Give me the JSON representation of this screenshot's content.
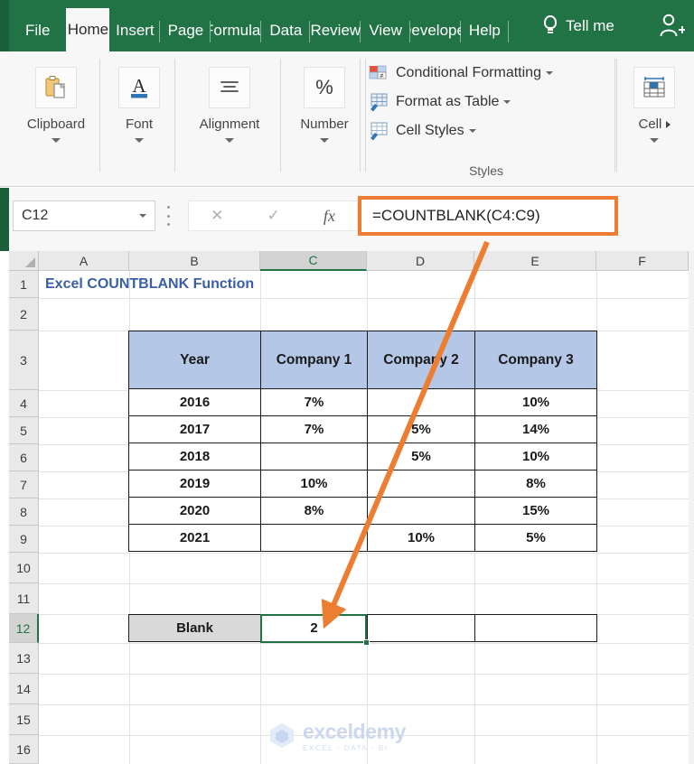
{
  "ribbon": {
    "tabs": [
      {
        "label": "File",
        "active": false
      },
      {
        "label": "Home",
        "active": true
      },
      {
        "label": "Insert",
        "active": false
      },
      {
        "label": "Page",
        "active": false
      },
      {
        "label": "Formulas",
        "active": false
      },
      {
        "label": "Data",
        "active": false
      },
      {
        "label": "Review",
        "active": false
      },
      {
        "label": "View",
        "active": false
      },
      {
        "label": "Developer",
        "active": false
      },
      {
        "label": "Help",
        "active": false
      }
    ],
    "tell_me": "Tell me",
    "groups": [
      {
        "label": "Clipboard",
        "icon": "clipboard-icon"
      },
      {
        "label": "Font",
        "icon": "font-a-icon"
      },
      {
        "label": "Alignment",
        "icon": "alignment-icon"
      },
      {
        "label": "Number",
        "icon": "percent-icon"
      },
      {
        "label": "Cell",
        "icon": "cells-icon"
      }
    ],
    "styles": {
      "title": "Styles",
      "items": [
        {
          "label": "Conditional Formatting",
          "icon": "conditional-formatting-icon"
        },
        {
          "label": "Format as Table",
          "icon": "format-as-table-icon"
        },
        {
          "label": "Cell Styles",
          "icon": "cell-styles-icon"
        }
      ]
    }
  },
  "formula_bar": {
    "name_box_value": "C12",
    "cancel_icon": "✕",
    "confirm_icon": "✓",
    "fx_label": "fx",
    "formula": "=COUNTBLANK(C4:C9)",
    "highlight_color": "#ED7D31"
  },
  "grid": {
    "columns": [
      "A",
      "B",
      "C",
      "D",
      "E",
      "F"
    ],
    "selected_column": "C",
    "rows": [
      "1",
      "2",
      "3",
      "4",
      "5",
      "6",
      "7",
      "8",
      "9",
      "10",
      "11",
      "12",
      "13",
      "14",
      "15",
      "16"
    ],
    "selected_row": "12",
    "sheet_title": "Excel COUNTBLANK Function",
    "selected_cell": "C12"
  },
  "data_table": {
    "headers": [
      "Year",
      "Company 1",
      "Company 2",
      "Company 3"
    ],
    "rows": [
      [
        "2016",
        "7%",
        "",
        "10%"
      ],
      [
        "2017",
        "7%",
        "5%",
        "14%"
      ],
      [
        "2018",
        "",
        "5%",
        "10%"
      ],
      [
        "2019",
        "10%",
        "",
        "8%"
      ],
      [
        "2020",
        "8%",
        "",
        "15%"
      ],
      [
        "2021",
        "",
        "10%",
        "5%"
      ]
    ],
    "header_bg": "#B4C7E7"
  },
  "result_row": {
    "label": "Blank",
    "value": "2",
    "empty_cells": [
      "",
      ""
    ]
  },
  "watermark": {
    "brand": "exceldemy",
    "tagline": "EXCEL - DATA - BI"
  }
}
